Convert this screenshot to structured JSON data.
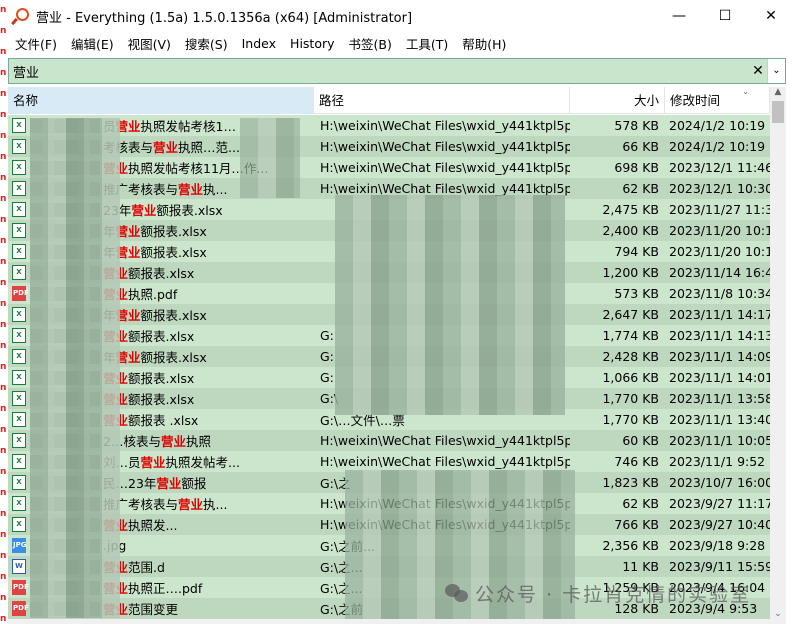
{
  "window": {
    "title": "营业 - Everything (1.5a) 1.5.0.1356a (x64) [Administrator]",
    "minimize": "—",
    "maximize": "☐",
    "close": "✕"
  },
  "menu": [
    "文件(F)",
    "编辑(E)",
    "视图(V)",
    "搜索(S)",
    "Index",
    "History",
    "书签(B)",
    "工具(T)",
    "帮助(H)"
  ],
  "search": {
    "value": "营业",
    "clear_icon": "✕",
    "dropdown_icon": "⌄"
  },
  "columns": {
    "name": "名称",
    "path": "路径",
    "size": "大小",
    "date": "修改时间"
  },
  "highlight_color": "#e00000",
  "rows": [
    {
      "type": "xlsx",
      "pre": "员",
      "hl": "营业",
      "post": "执照发帖考核1…",
      "path": "H:\\weixin\\WeChat Files\\wxid_y441ktpl5pp...",
      "size": "578 KB",
      "date": "2024/1/2 10:19"
    },
    {
      "type": "xlsx",
      "pre": "考核表与",
      "hl": "营业",
      "post": "执照…范...",
      "path": "H:\\weixin\\WeChat Files\\wxid_y441ktpl5pp...",
      "size": "66 KB",
      "date": "2024/1/2 10:19"
    },
    {
      "type": "xlsx",
      "pre": "",
      "hl": "营业",
      "post": "执照发帖考核11月…作...",
      "path": "H:\\weixin\\WeChat Files\\wxid_y441ktpl5pp...",
      "size": "698 KB",
      "date": "2023/12/1 11:46"
    },
    {
      "type": "xlsx",
      "pre": "推广考核表与",
      "hl": "营业",
      "post": "执...",
      "path": "H:\\weixin\\WeChat Files\\wxid_y441ktpl5pp...",
      "size": "62 KB",
      "date": "2023/12/1 10:30"
    },
    {
      "type": "xlsx",
      "pre": "23年",
      "hl": "营业",
      "post": "额报表.xlsx",
      "path": "",
      "size": "2,475 KB",
      "date": "2023/11/27 11:35"
    },
    {
      "type": "xlsx",
      "pre": "年",
      "hl": "营业",
      "post": "额报表.xlsx",
      "path": "",
      "size": "2,400 KB",
      "date": "2023/11/20 10:18"
    },
    {
      "type": "xlsx",
      "pre": "年",
      "hl": "营业",
      "post": "额报表.xlsx",
      "path": "",
      "size": "794 KB",
      "date": "2023/11/20 10:17"
    },
    {
      "type": "xlsx",
      "pre": "",
      "hl": "营业",
      "post": "额报表.xlsx",
      "path": "",
      "size": "1,200 KB",
      "date": "2023/11/14 16:47"
    },
    {
      "type": "pdf",
      "pre": "",
      "hl": "营业",
      "post": "执照.pdf",
      "path": "",
      "size": "573 KB",
      "date": "2023/11/8 10:34"
    },
    {
      "type": "xlsx",
      "pre": "年",
      "hl": "营业",
      "post": "额报表.xlsx",
      "path": "",
      "size": "2,647 KB",
      "date": "2023/11/1 14:17"
    },
    {
      "type": "xlsx",
      "pre": "",
      "hl": "营业",
      "post": "额报表.xlsx",
      "path": "G:",
      "size": "1,774 KB",
      "date": "2023/11/1 14:13"
    },
    {
      "type": "xlsx",
      "pre": "年",
      "hl": "营业",
      "post": "额报表.xlsx",
      "path": "G:",
      "size": "2,428 KB",
      "date": "2023/11/1 14:09"
    },
    {
      "type": "xlsx",
      "pre": "",
      "hl": "营业",
      "post": "额报表.xlsx",
      "path": "G:",
      "size": "1,066 KB",
      "date": "2023/11/1 14:01"
    },
    {
      "type": "xlsx",
      "pre": "",
      "hl": "营业",
      "post": "额报表.xlsx",
      "path": "G:\\",
      "size": "1,770 KB",
      "date": "2023/11/1 13:58"
    },
    {
      "type": "xlsx",
      "pre": "",
      "hl": "营业",
      "post": "额报表 .xlsx",
      "path": "G:\\…文件\\…票",
      "size": "1,770 KB",
      "date": "2023/11/1 13:40"
    },
    {
      "type": "xlsx",
      "pre": "2…核表与",
      "hl": "营业",
      "post": "执照",
      "path": "H:\\weixin\\WeChat Files\\wxid_y441ktpl5pp...",
      "size": "60 KB",
      "date": "2023/11/1 10:05"
    },
    {
      "type": "xlsx",
      "pre": "刘…员",
      "hl": "营业",
      "post": "执照发帖考...",
      "path": "H:\\weixin\\WeChat Files\\wxid_y441ktpl5pp...",
      "size": "746 KB",
      "date": "2023/11/1 9:52"
    },
    {
      "type": "xlsx",
      "pre": "民…23年",
      "hl": "营业",
      "post": "额报",
      "path": "G:\\之",
      "size": "1,823 KB",
      "date": "2023/10/7 16:00"
    },
    {
      "type": "xlsx",
      "pre": "推广考核表与",
      "hl": "营业",
      "post": "执...",
      "path": "H:\\weixin\\WeChat Files\\wxid_y441ktpl5pp...",
      "size": "62 KB",
      "date": "2023/9/27 11:17"
    },
    {
      "type": "xlsx",
      "pre": "",
      "hl": "营业",
      "post": "执照发...",
      "path": "H:\\weixin\\WeChat Files\\wxid_y441ktpl5pp...",
      "size": "766 KB",
      "date": "2023/9/27 10:40"
    },
    {
      "type": "jpg",
      "pre": "",
      "hl": "",
      "post": ".jpg",
      "path": "G:\\之前...",
      "size": "2,356 KB",
      "date": "2023/9/18 9:28"
    },
    {
      "type": "docx",
      "pre": "",
      "hl": "营业",
      "post": "范围.d",
      "path": "G:\\之...",
      "size": "11 KB",
      "date": "2023/9/11 15:59"
    },
    {
      "type": "pdf",
      "pre": "",
      "hl": "营业",
      "post": "执照正….pdf",
      "path": "G:\\之...",
      "size": "1,259 KB",
      "date": "2023/9/4 16:04"
    },
    {
      "type": "pdf",
      "pre": "",
      "hl": "营业",
      "post": "范围变更",
      "path": "G:\\之前",
      "size": "128 KB",
      "date": "2023/9/4 9:53"
    }
  ],
  "watermark": "公众号 · 卡拉肖克情的实验室"
}
